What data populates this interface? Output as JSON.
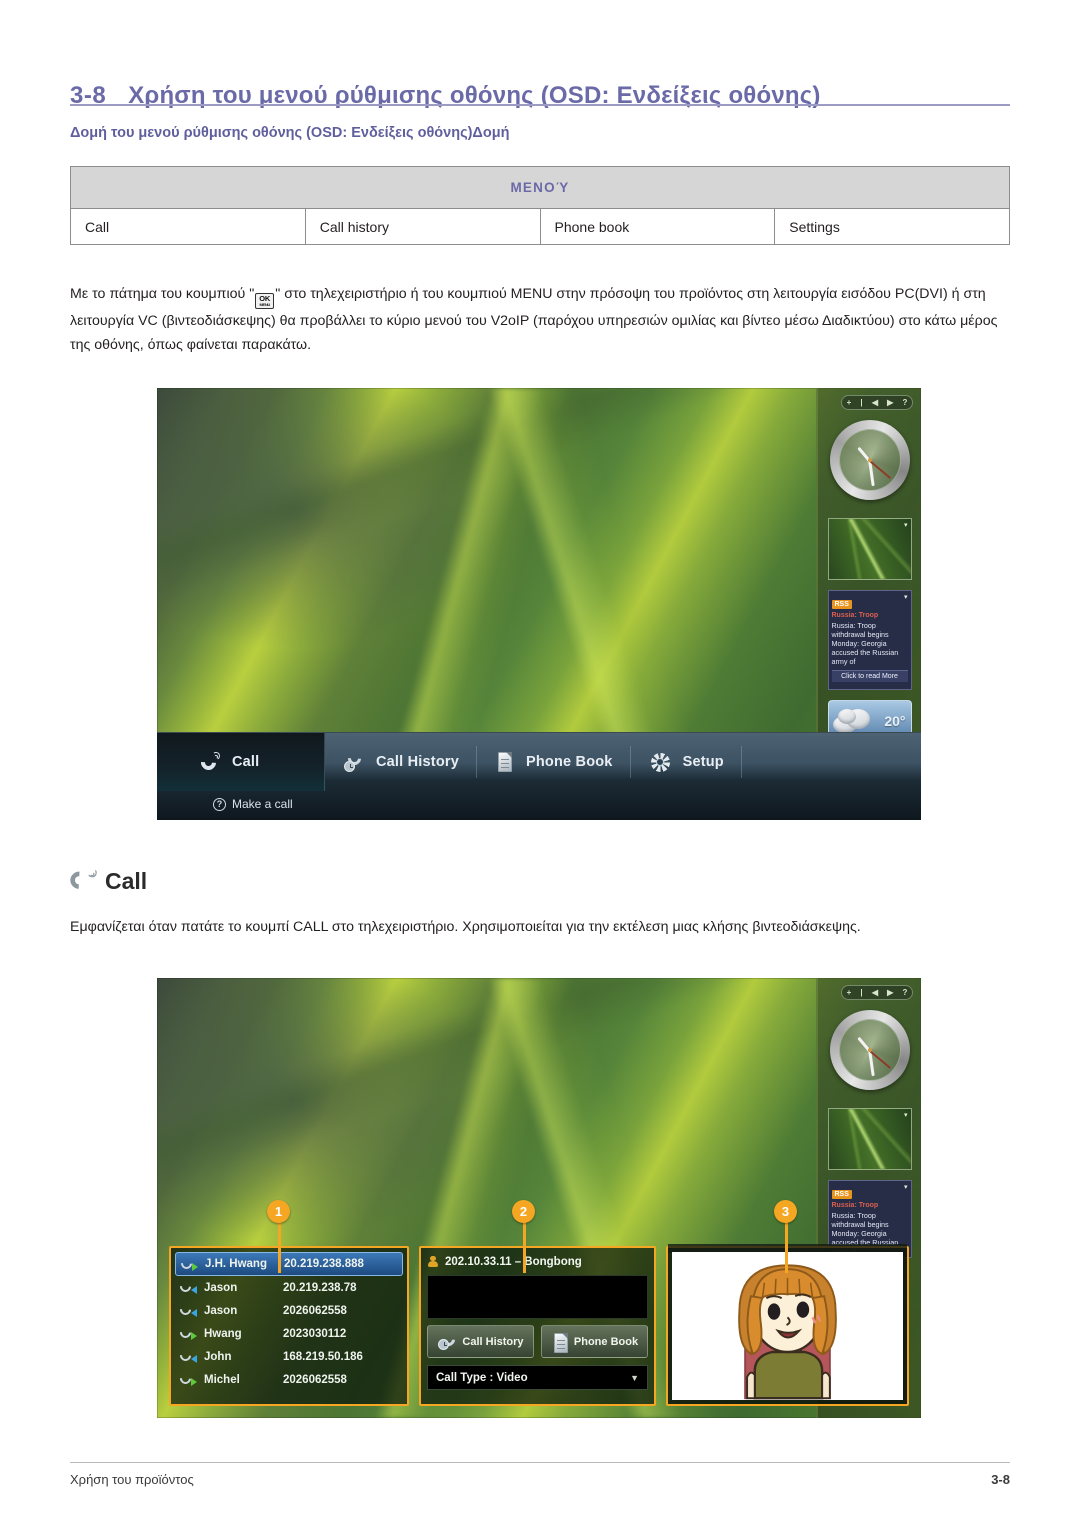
{
  "header": {
    "section_number": "3-8",
    "section_title": "Χρήση του μενού ρύθμισης οθόνης (OSD: Ενδείξεις οθόνης)",
    "sub_heading": "Δομή του μενού ρύθμισης οθόνης (OSD: Ενδείξεις οθόνης)Δομή"
  },
  "menu_table": {
    "header": "ΜΕΝΟΎ",
    "cells": [
      "Call",
      "Call history",
      "Phone book",
      "Settings"
    ]
  },
  "paragraph1": {
    "before_button": "Με το πάτημα του κουμπιού \"",
    "button_top": "OK",
    "button_bottom": "MENU",
    "after_button": "\" στο τηλεχειριστήριο ή του κουμπιού MENU στην πρόσοψη του προϊόντος στη λειτουργία εισόδου PC(DVI) ή στη λειτουργία VC (βιντεοδιάσκεψης) θα προβάλλει το κύριο μενού του V2oIP (παρόχου υπηρεσιών ομιλίας και βίντεο μέσω Διαδικτύου) στο κάτω μέρος της οθόνης, όπως φαίνεται παρακάτω."
  },
  "call_section": {
    "heading": "Call",
    "paragraph": "Εμφανίζεται όταν πατάτε το κουμπί CALL στο τηλεχειριστήριο. Χρησιμοποιείται για την εκτέλεση μιας κλήσης βιντεοδιάσκεψης."
  },
  "screenshot1": {
    "rail": {
      "controls": [
        "+",
        "|",
        "◀",
        "▶",
        "?"
      ],
      "rss": {
        "tag": "RSS",
        "title": "Russia: Troop",
        "body": "Russia: Troop withdrawal begins Monday: Georgia accused the Russian army of",
        "more": "Click to read More"
      },
      "weather": {
        "temperature": "20°"
      }
    },
    "osd": {
      "items": [
        {
          "label": "Call",
          "icon": "phone-icon"
        },
        {
          "label": "Call History",
          "icon": "call-history-icon"
        },
        {
          "label": "Phone Book",
          "icon": "phone-book-icon"
        },
        {
          "label": "Setup",
          "icon": "gear-icon"
        }
      ],
      "hint": "Make a call"
    }
  },
  "screenshot2": {
    "callouts": [
      "1",
      "2",
      "3"
    ],
    "contact_list": [
      {
        "direction": "out",
        "name": "J.H. Hwang",
        "number": "20.219.238.888",
        "selected": true
      },
      {
        "direction": "in",
        "name": "Jason",
        "number": "20.219.238.78",
        "selected": false
      },
      {
        "direction": "in",
        "name": "Jason",
        "number": "2026062558",
        "selected": false
      },
      {
        "direction": "out",
        "name": "Hwang",
        "number": "2023030112",
        "selected": false
      },
      {
        "direction": "in",
        "name": "John",
        "number": "168.219.50.186",
        "selected": false
      },
      {
        "direction": "out",
        "name": "Michel",
        "number": "2026062558",
        "selected": false
      }
    ],
    "dial_panel": {
      "title": "202.10.33.11 – Bongbong",
      "input_value": "",
      "buttons": [
        {
          "label": "Call History",
          "icon": "call-history-icon"
        },
        {
          "label": "Phone Book",
          "icon": "phone-book-icon"
        }
      ],
      "call_type": "Call Type : Video"
    }
  },
  "footer": {
    "left": "Χρήση του προϊόντος",
    "right": "3-8"
  },
  "colors": {
    "heading_purple": "#6a6aa8",
    "table_header_bg": "#d6d6d6",
    "callout_orange": "#f5a623",
    "selection_blue": "#3d79b8"
  }
}
